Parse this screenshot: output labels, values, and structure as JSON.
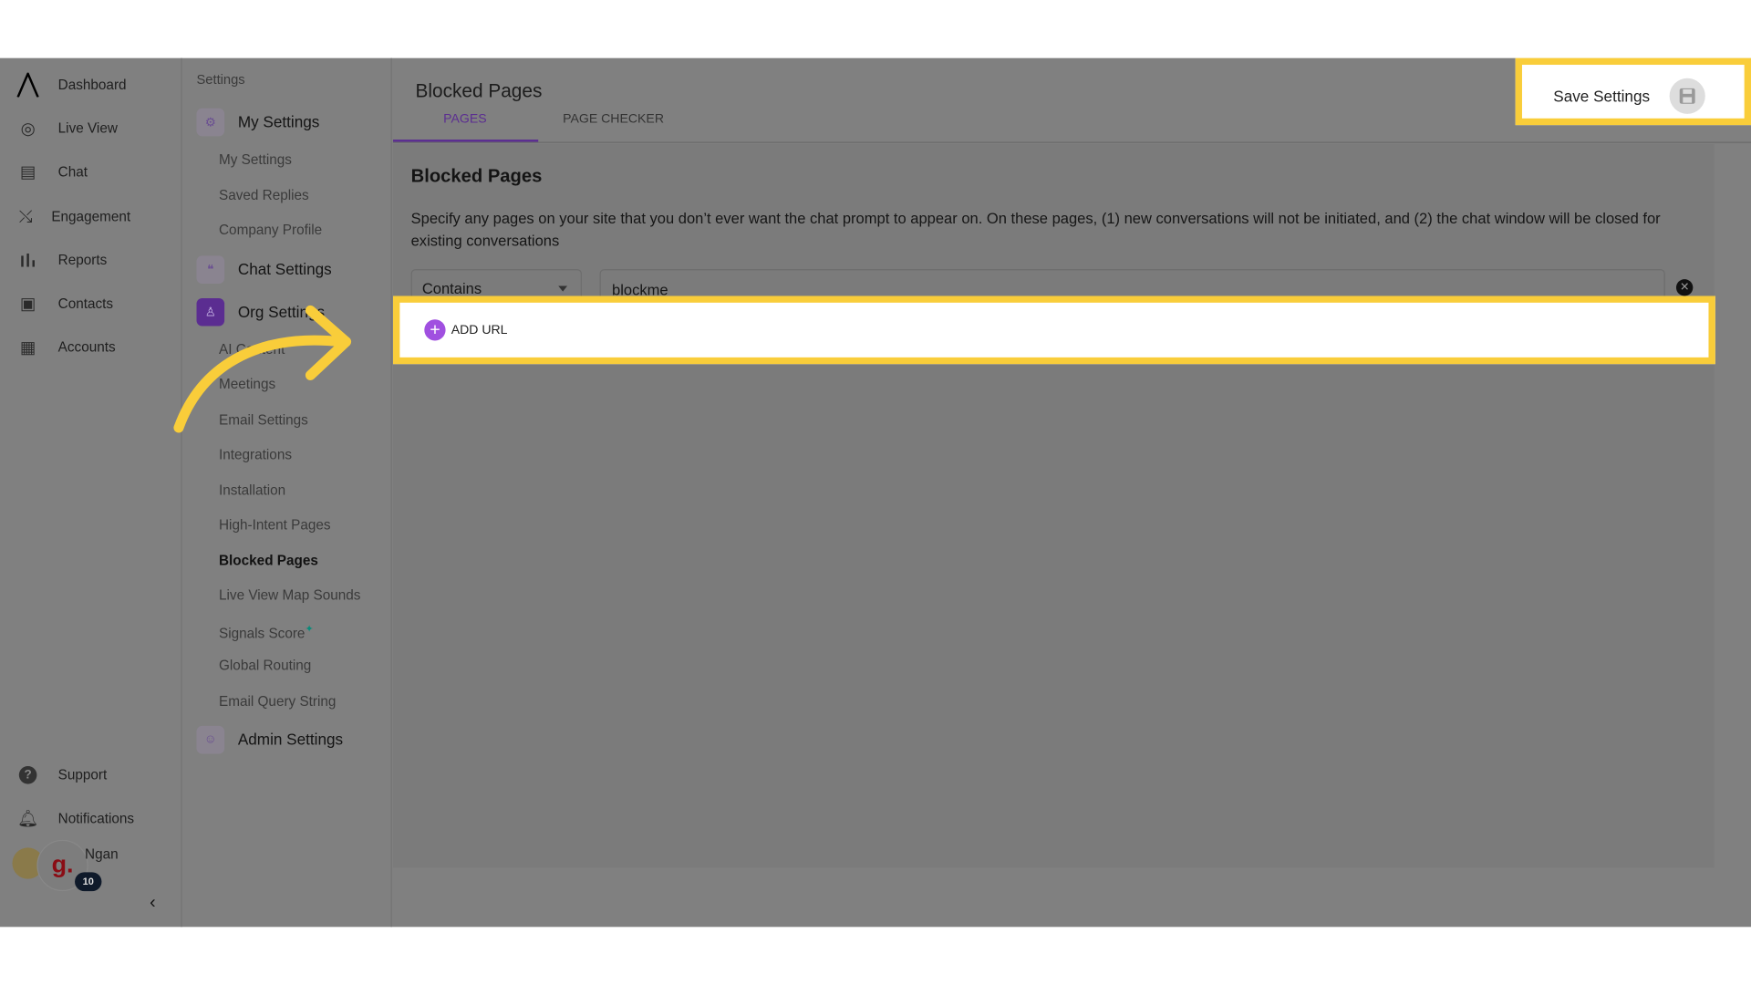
{
  "nav": {
    "items": [
      {
        "label": "Dashboard",
        "icon": "logo-icon"
      },
      {
        "label": "Live View",
        "icon": "live-view-icon"
      },
      {
        "label": "Chat",
        "icon": "chat-icon"
      },
      {
        "label": "Engagement",
        "icon": "engagement-icon"
      },
      {
        "label": "Reports",
        "icon": "reports-icon"
      },
      {
        "label": "Contacts",
        "icon": "contacts-icon"
      },
      {
        "label": "Accounts",
        "icon": "accounts-icon"
      }
    ],
    "support": "Support",
    "notifications": "Notifications",
    "user_name": "Ngan",
    "org_initial": "g.",
    "badge_count": "10",
    "collapse_icon": "chevron-left-icon"
  },
  "settings": {
    "heading": "Settings",
    "my_settings": "My Settings",
    "my_settings_items": [
      "My Settings",
      "Saved Replies",
      "Company Profile"
    ],
    "chat_settings": "Chat Settings",
    "org_settings": "Org Settings",
    "org_items": [
      "AI Content",
      "Meetings",
      "Email Settings",
      "Integrations",
      "Installation",
      "High-Intent Pages",
      "Blocked Pages",
      "Live View Map Sounds",
      "Signals Score",
      "Global Routing",
      "Email Query String"
    ],
    "signals_mark": "✦",
    "admin_settings": "Admin Settings",
    "active_item": "Blocked Pages"
  },
  "main": {
    "title": "Blocked Pages",
    "tabs": [
      {
        "label": "PAGES",
        "active": true
      },
      {
        "label": "PAGE CHECKER",
        "active": false
      }
    ],
    "save_label": "Save Settings",
    "card_title": "Blocked Pages",
    "description": "Specify any pages on your site that you don’t ever want the chat prompt to appear on. On these pages, (1) new conversations will not be initiated, and (2) the chat window will be closed for existing conversations",
    "rule": {
      "match_type": "Contains",
      "value": "blockme"
    },
    "add_url": "ADD URL"
  },
  "colors": {
    "accent": "#5b2d91",
    "highlight": "#f9cd3a",
    "add_icon": "#a050e0"
  }
}
